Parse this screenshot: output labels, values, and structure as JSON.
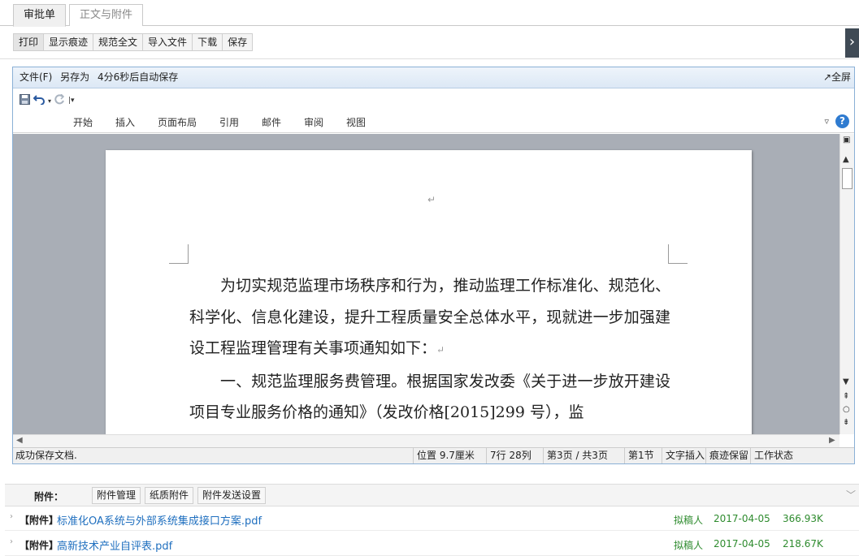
{
  "tabs": [
    {
      "label": "审批单",
      "active": true
    },
    {
      "label": "正文与附件",
      "active": false
    }
  ],
  "toolbar": {
    "buttons": [
      "打印",
      "显示痕迹",
      "规范全文",
      "导入文件",
      "下载",
      "保存"
    ],
    "side_arrow": "›"
  },
  "editor": {
    "file_menu": "文件(F)",
    "save_as": "另存为",
    "autosave": "4分6秒后自动保存",
    "fullscreen": "↗全屏",
    "ribbon_tabs": [
      "开始",
      "插入",
      "页面布局",
      "引用",
      "邮件",
      "审阅",
      "视图"
    ],
    "document": {
      "top_mark": "↵",
      "paragraphs": [
        "为切实规范监理市场秩序和行为，推动监理工作标准化、规范化、科学化、信息化建设，提升工程质量安全总体水平，现就进一步加强建设工程监理管理有关事项通知如下：",
        "一、规范监理服务费管理。根据国家发改委《关于进一步放开建设项目专业服务价格的通知》（发改价格[2015]299 号），监"
      ],
      "para_mark": "↵"
    },
    "status": {
      "message": "成功保存文档.",
      "position": "位置 9.7厘米",
      "line_col": "7行 28列",
      "page": "第3页 / 共3页",
      "section": "第1节",
      "insert_mode": "文字插入",
      "track": "痕迹保留",
      "work_state": "工作状态"
    }
  },
  "attachments": {
    "title": "附件：",
    "buttons": [
      "附件管理",
      "纸质附件",
      "附件发送设置"
    ],
    "items": [
      {
        "tag": "【附件】",
        "name": "标准化OA系统与外部系统集成接口方案.pdf",
        "author": "拟稿人",
        "date": "2017-04-05",
        "size": "366.93K"
      },
      {
        "tag": "【附件】",
        "name": "高新技术产业自评表.pdf",
        "author": "拟稿人",
        "date": "2017-04-05",
        "size": "218.67K"
      }
    ]
  },
  "colors": {
    "link": "#1f6fbf",
    "meta_green": "#2e8b2e",
    "frame_border": "#8ab0d6"
  }
}
